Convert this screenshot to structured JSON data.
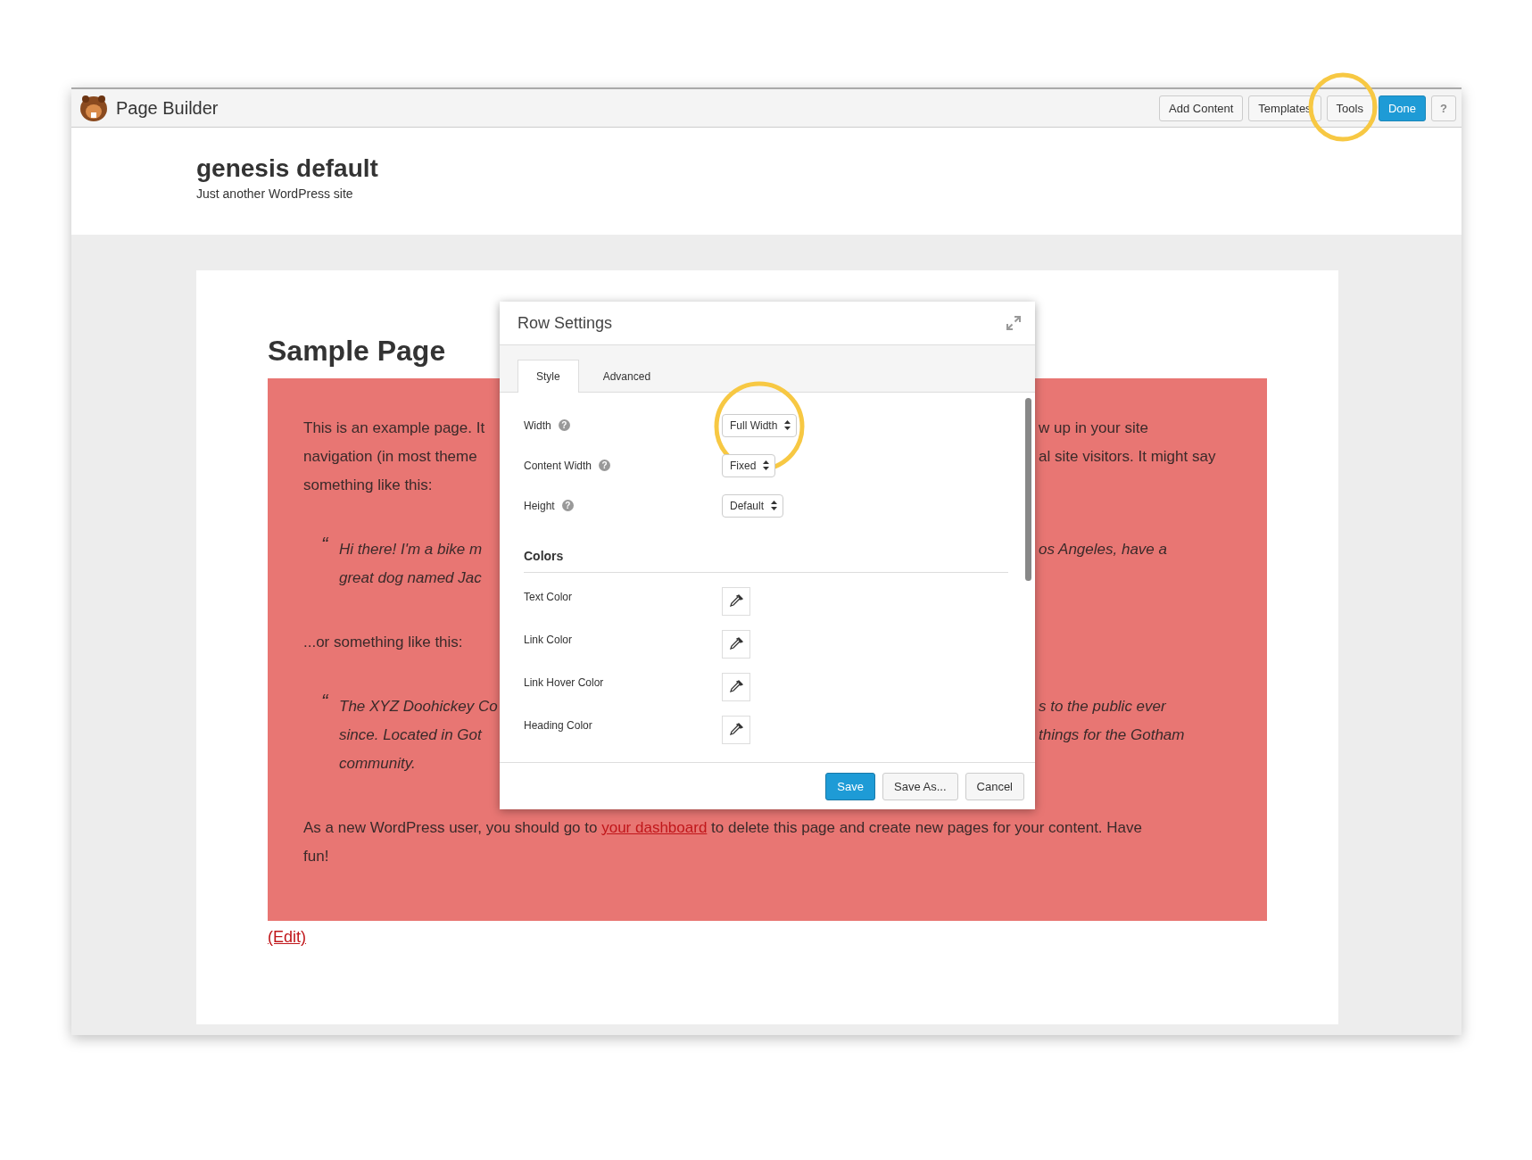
{
  "topbar": {
    "title": "Page Builder",
    "buttons": [
      {
        "label": "Add Content",
        "kind": "default"
      },
      {
        "label": "Templates",
        "kind": "default"
      },
      {
        "label": "Tools",
        "kind": "default"
      },
      {
        "label": "Done",
        "kind": "primary"
      },
      {
        "label": "?",
        "kind": "help"
      }
    ]
  },
  "site": {
    "title": "genesis default",
    "tagline": "Just another WordPress site"
  },
  "page": {
    "title": "Sample Page",
    "blocks": [
      {
        "kind": "para",
        "lines": [
          {
            "left": "This is an example page. It",
            "right": "w up in your site"
          },
          {
            "left": "navigation (in most theme",
            "right": "al site visitors. It might say"
          },
          {
            "left": "something like this:"
          }
        ]
      },
      {
        "kind": "quote",
        "mark": "“",
        "lines": [
          {
            "left": "Hi there! I'm a bike m",
            "right": "os Angeles, have a"
          },
          {
            "left": "great dog named Jac"
          }
        ]
      },
      {
        "kind": "para",
        "lines": [
          {
            "left": "...or something like this:"
          }
        ]
      },
      {
        "kind": "quote",
        "mark": "“",
        "lines": [
          {
            "left": "The XYZ Doohickey Co",
            "right": "s to the public ever"
          },
          {
            "left": "since. Located in Got",
            "right": "things for the Gotham"
          },
          {
            "left": "community."
          }
        ]
      }
    ],
    "final": {
      "before": "As a new WordPress user, you should go to ",
      "link": "your dashboard",
      "after": " to delete this page and create new pages for your content. Have fun!"
    },
    "edit_link": "(Edit)"
  },
  "modal": {
    "title": "Row Settings",
    "tabs": [
      {
        "label": "Style",
        "selected": true
      },
      {
        "label": "Advanced",
        "selected": false
      }
    ],
    "fields": [
      {
        "label": "Width",
        "help": "?",
        "value": "Full Width"
      },
      {
        "label": "Content Width",
        "help": "?",
        "value": "Fixed"
      },
      {
        "label": "Height",
        "help": "?",
        "value": "Default"
      }
    ],
    "section": "Colors",
    "colors": [
      {
        "label": "Text Color"
      },
      {
        "label": "Link Color"
      },
      {
        "label": "Link Hover Color"
      },
      {
        "label": "Heading Color"
      }
    ],
    "buttons": [
      {
        "label": "Save",
        "kind": "primary"
      },
      {
        "label": "Save As...",
        "kind": "default"
      },
      {
        "label": "Cancel",
        "kind": "default"
      }
    ]
  }
}
